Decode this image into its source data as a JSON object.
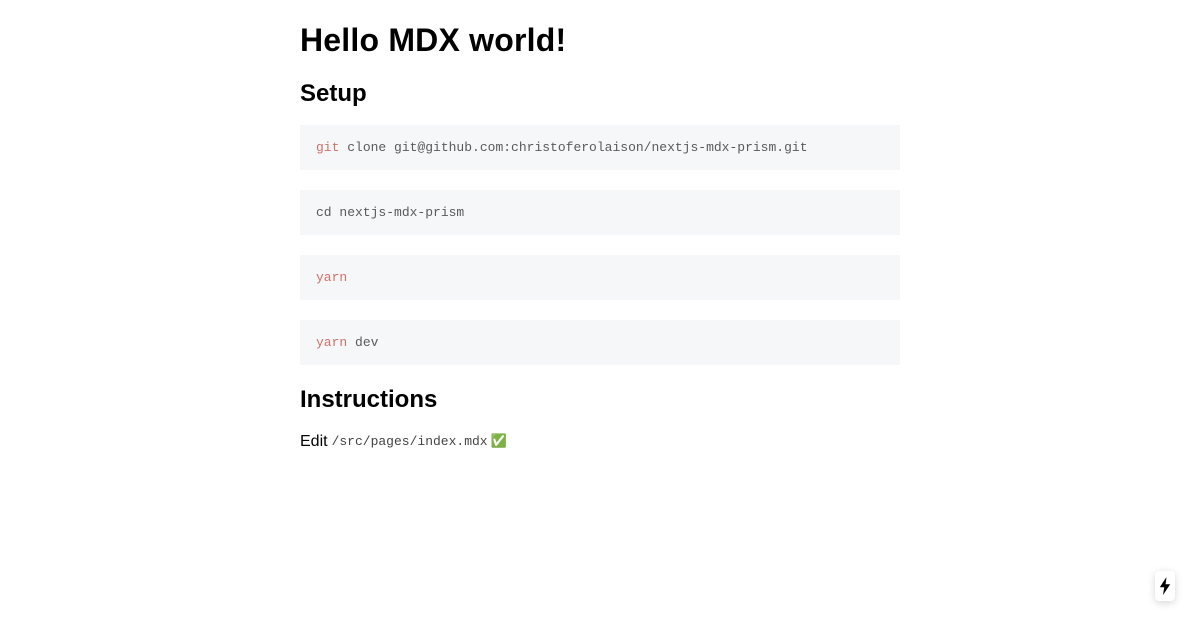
{
  "main": {
    "title": "Hello MDX world!",
    "setup_heading": "Setup",
    "code_blocks": [
      {
        "command": "git",
        "args": "clone git@github.com:christoferolaison/nextjs-mdx-prism.git"
      },
      {
        "command": "",
        "args": "cd nextjs-mdx-prism"
      },
      {
        "command": "yarn",
        "args": ""
      },
      {
        "command": "yarn",
        "args": "dev"
      }
    ],
    "instructions_heading": "Instructions",
    "instruction": {
      "text": "Edit",
      "path": "/src/pages/index.mdx",
      "emoji": "✅"
    }
  },
  "indicator": {
    "icon": "lightning-bolt-icon"
  },
  "colors": {
    "keyword": "#d0706b",
    "code_background": "#f6f7f8",
    "code_text": "#5a5a5a"
  }
}
